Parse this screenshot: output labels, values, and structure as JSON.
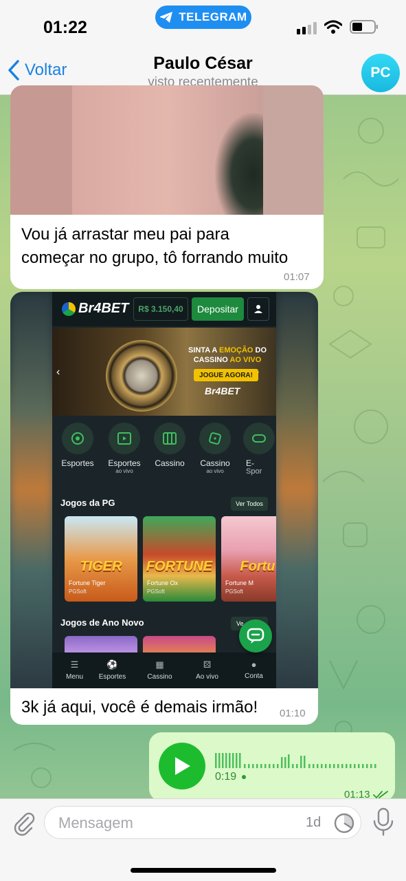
{
  "status_bar": {
    "time": "01:22",
    "pill_label": "TELEGRAM"
  },
  "header": {
    "back_label": "Voltar",
    "contact_name": "Paulo César",
    "contact_status": "visto recentemente",
    "avatar_initials": "PC"
  },
  "messages": [
    {
      "direction": "incoming",
      "has_photo": true,
      "text_line1": "Vou já arrastar meu pai para",
      "text_line2": "começar no grupo, tô forrando muito",
      "time": "01:07"
    },
    {
      "direction": "incoming",
      "has_screenshot": true,
      "text": "3k já aqui, você é demais irmão!",
      "time": "01:10",
      "screenshot": {
        "brand": "Br4BET",
        "balance": "R$ 3.150,40",
        "deposit_label": "Depositar",
        "banner_line1": "SINTA A",
        "banner_hl1": "EMOÇÃO",
        "banner_line1b": "DO",
        "banner_line2": "CASSINO",
        "banner_hl2": "AO VIVO",
        "banner_cta": "JOGUE AGORA!",
        "banner_logo": "Br4BET",
        "categories": [
          {
            "label": "Esportes",
            "sub": ""
          },
          {
            "label": "Esportes",
            "sub": "ao vivo"
          },
          {
            "label": "Cassino",
            "sub": ""
          },
          {
            "label": "Cassino",
            "sub": "ao vivo"
          },
          {
            "label": "E-",
            "sub": "Spor"
          }
        ],
        "section1_title": "Jogos da PG",
        "section1_see_all": "Ver Todos",
        "games": [
          {
            "title": "Fortune Tiger",
            "provider": "PGSoft",
            "art": "TIGER"
          },
          {
            "title": "Fortune Ox",
            "provider": "PGSoft",
            "art": "FORTUNE"
          },
          {
            "title": "Fortune M",
            "provider": "PGSoft",
            "art": "Fortu"
          }
        ],
        "section2_title": "Jogos de Ano Novo",
        "section2_see_all": "Ve",
        "nav": [
          "Menu",
          "Esportes",
          "Cassino",
          "Ao vivo",
          "Conta"
        ]
      }
    },
    {
      "direction": "outgoing",
      "type": "voice",
      "duration": "0:19",
      "time": "01:13",
      "waveform_text": "||||||||..........|||...||.........................."
    }
  ],
  "input": {
    "placeholder": "Mensagem",
    "timer_label": "1d"
  },
  "colors": {
    "accent": "#1a82e2",
    "outgoing_bubble": "#dcf9c9",
    "play_button": "#1dbc2f"
  }
}
